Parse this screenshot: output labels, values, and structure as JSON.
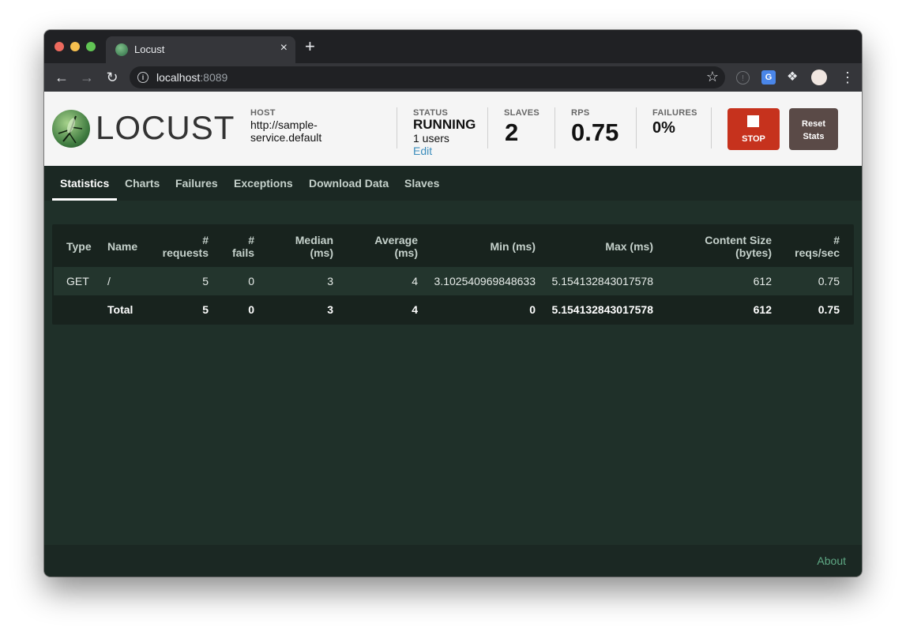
{
  "browser": {
    "tab_title": "Locust",
    "tab_close": "×",
    "new_tab": "+",
    "url_host": "localhost",
    "url_port": ":8089",
    "icons": [
      "back-icon",
      "forward-icon",
      "reload-icon",
      "info-icon",
      "star-icon",
      "extension-icon",
      "translate-icon",
      "puzzle-icon",
      "profile-avatar",
      "menu-icon"
    ]
  },
  "header": {
    "logo_text": "LOCUST",
    "host_label": "HOST",
    "host_value": "http://sample-service.default",
    "status_label": "STATUS",
    "status_value": "RUNNING",
    "users_value": "1 users",
    "edit_label": "Edit",
    "slaves_label": "SLAVES",
    "slaves_value": "2",
    "rps_label": "RPS",
    "rps_value": "0.75",
    "failures_label": "FAILURES",
    "failures_value": "0%",
    "stop_label": "STOP",
    "reset_label_1": "Reset",
    "reset_label_2": "Stats",
    "stop_color": "#c6321d",
    "reset_color": "#5a4a47"
  },
  "nav": {
    "tabs": [
      {
        "label": "Statistics",
        "active": true
      },
      {
        "label": "Charts"
      },
      {
        "label": "Failures"
      },
      {
        "label": "Exceptions"
      },
      {
        "label": "Download Data"
      },
      {
        "label": "Slaves"
      }
    ]
  },
  "table": {
    "headers": {
      "type": "Type",
      "name": "Name",
      "requests_1": "#",
      "requests_2": "requests",
      "fails_1": "#",
      "fails_2": "fails",
      "median_1": "Median",
      "median_2": "(ms)",
      "average_1": "Average",
      "average_2": "(ms)",
      "min": "Min (ms)",
      "max": "Max (ms)",
      "size_1": "Content Size",
      "size_2": "(bytes)",
      "rps_1": "#",
      "rps_2": "reqs/sec"
    },
    "rows": [
      {
        "type": "GET",
        "name": "/",
        "requests": "5",
        "fails": "0",
        "median": "3",
        "average": "4",
        "min": "3.102540969848633",
        "max": "5.154132843017578",
        "size": "612",
        "rps": "0.75"
      }
    ],
    "total": {
      "type": "",
      "name": "Total",
      "requests": "5",
      "fails": "0",
      "median": "3",
      "average": "4",
      "min": "0",
      "max": "5.154132843017578",
      "size": "612",
      "rps": "0.75"
    }
  },
  "footer": {
    "about_label": "About"
  }
}
